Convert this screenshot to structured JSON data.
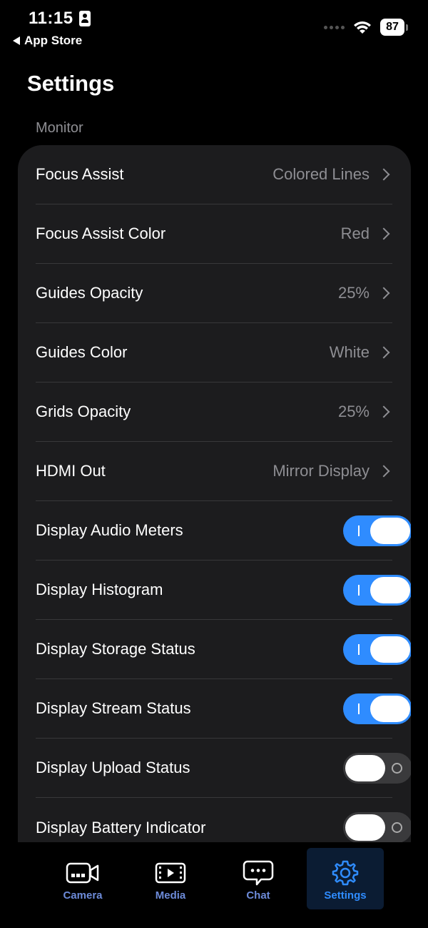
{
  "status": {
    "time": "11:15",
    "back_label": "App Store",
    "battery": "87"
  },
  "page_title": "Settings",
  "section_header": "Monitor",
  "rows": [
    {
      "label": "Focus Assist",
      "value": "Colored Lines"
    },
    {
      "label": "Focus Assist Color",
      "value": "Red"
    },
    {
      "label": "Guides Opacity",
      "value": "25%"
    },
    {
      "label": "Guides Color",
      "value": "White"
    },
    {
      "label": "Grids Opacity",
      "value": "25%"
    },
    {
      "label": "HDMI Out",
      "value": "Mirror Display"
    },
    {
      "label": "Display Audio Meters",
      "toggle": true
    },
    {
      "label": "Display Histogram",
      "toggle": true
    },
    {
      "label": "Display Storage Status",
      "toggle": true
    },
    {
      "label": "Display Stream Status",
      "toggle": true
    },
    {
      "label": "Display Upload Status",
      "toggle": false
    },
    {
      "label": "Display Battery Indicator",
      "toggle": false
    }
  ],
  "tabs": [
    {
      "label": "Camera",
      "icon": "video-camera-icon"
    },
    {
      "label": "Media",
      "icon": "film-icon"
    },
    {
      "label": "Chat",
      "icon": "chat-bubble-icon"
    },
    {
      "label": "Settings",
      "icon": "gear-icon",
      "active": true
    }
  ],
  "colors": {
    "accent": "#2f8cff",
    "card_bg": "#1c1c1e",
    "secondary_text": "#8e8e93",
    "tab_inactive": "#6d8bd9"
  }
}
